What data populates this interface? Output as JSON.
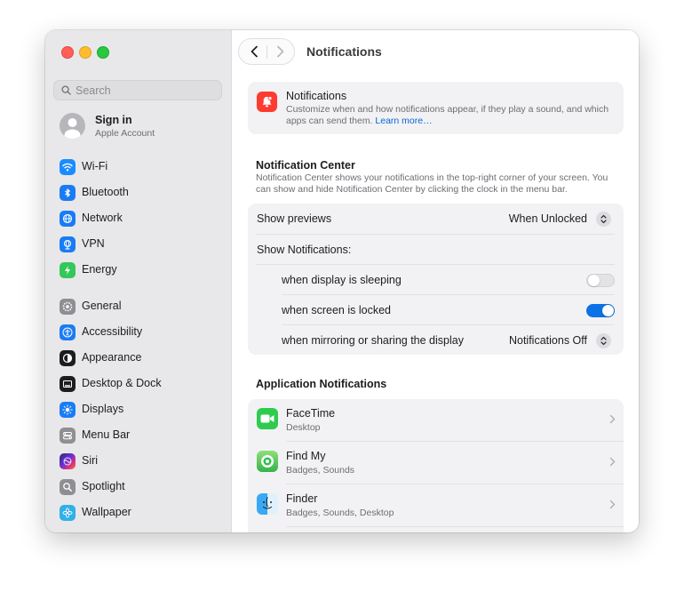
{
  "sidebar": {
    "search_placeholder": "Search",
    "account": {
      "name": "Sign in",
      "subtitle": "Apple Account"
    },
    "items": [
      {
        "label": "Wi-Fi",
        "icon": "wifi-icon",
        "color": "#1a8cff"
      },
      {
        "label": "Bluetooth",
        "icon": "bluetooth-icon",
        "color": "#1a7cf5"
      },
      {
        "label": "Network",
        "icon": "globe-icon",
        "color": "#1a7cf5"
      },
      {
        "label": "VPN",
        "icon": "vpn-globe-icon",
        "color": "#1a7cf5"
      },
      {
        "label": "Energy",
        "icon": "bolt-icon",
        "color": "#34c759"
      },
      {
        "label": "General",
        "icon": "gear-icon",
        "color": "#8e8e93"
      },
      {
        "label": "Accessibility",
        "icon": "accessibility-icon",
        "color": "#1a7cf5"
      },
      {
        "label": "Appearance",
        "icon": "appearance-icon",
        "color": "#1d1d1f"
      },
      {
        "label": "Desktop & Dock",
        "icon": "dock-icon",
        "color": "#1d1d1f"
      },
      {
        "label": "Displays",
        "icon": "sun-icon",
        "color": "#1a7cf5"
      },
      {
        "label": "Menu Bar",
        "icon": "menubar-icon",
        "color": "#8e8e93"
      },
      {
        "label": "Siri",
        "icon": "siri-icon",
        "color": "#7a3cf0"
      },
      {
        "label": "Spotlight",
        "icon": "magnifier-icon",
        "color": "#8e8e93"
      },
      {
        "label": "Wallpaper",
        "icon": "flower-icon",
        "color": "#30b0e8"
      }
    ]
  },
  "header": {
    "title": "Notifications"
  },
  "banner": {
    "title": "Notifications",
    "description": "Customize when and how notifications appear, if they play a sound, and which apps can send them.",
    "link": "Learn more…"
  },
  "notification_center": {
    "title": "Notification Center",
    "description": "Notification Center shows your notifications in the top-right corner of your screen. You can show and hide Notification Center by clicking the clock in the menu bar.",
    "show_previews": {
      "label": "Show previews",
      "value": "When Unlocked"
    },
    "show_notifications_label": "Show Notifications:",
    "display_sleeping": {
      "label": "when display is sleeping",
      "enabled": false
    },
    "screen_locked": {
      "label": "when screen is locked",
      "enabled": true
    },
    "mirroring": {
      "label": "when mirroring or sharing the display",
      "value": "Notifications Off"
    }
  },
  "app_notifications": {
    "title": "Application Notifications",
    "apps": [
      {
        "name": "FaceTime",
        "detail": "Desktop"
      },
      {
        "name": "Find My",
        "detail": "Badges, Sounds"
      },
      {
        "name": "Finder",
        "detail": "Badges, Sounds, Desktop"
      }
    ]
  }
}
